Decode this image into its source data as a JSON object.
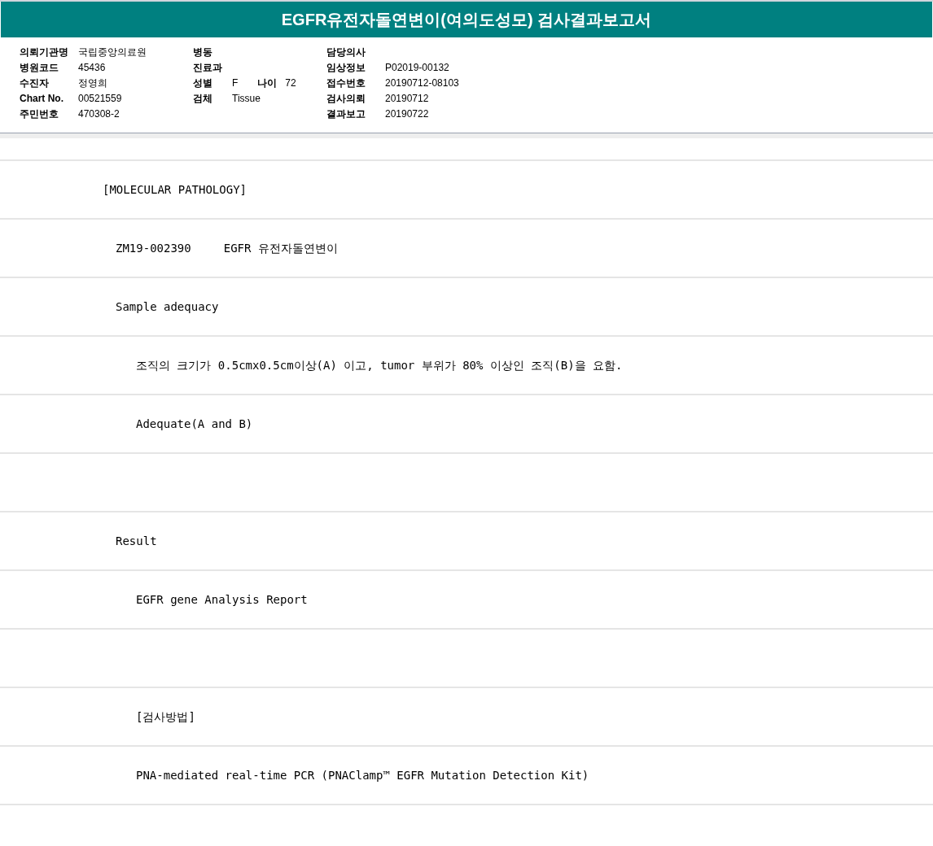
{
  "title": "EGFR유전자돌연변이(여의도성모) 검사결과보고서",
  "info_columns": [
    [
      [
        {
          "label": "의뢰기관명",
          "value": "국립중앙의료원"
        }
      ],
      [
        {
          "label": "병원코드",
          "value": "45436"
        }
      ],
      [
        {
          "label": "수진자",
          "value": "정영희"
        }
      ],
      [
        {
          "label": "Chart No.",
          "value": "00521559"
        }
      ],
      [
        {
          "label": "주민번호",
          "value": "470308-2"
        }
      ]
    ],
    [
      [
        {
          "label": "병동"
        }
      ],
      [
        {
          "label": "진료과"
        }
      ],
      [
        {
          "label": "성별",
          "value": "F"
        },
        {
          "label": "나이",
          "value": "72"
        }
      ],
      [
        {
          "label": "검체",
          "value": "Tissue"
        }
      ]
    ],
    [
      [
        {
          "label": "담당의사"
        }
      ],
      [
        {
          "label": "임상정보",
          "value": "P02019-00132"
        }
      ],
      [
        {
          "label": "접수번호",
          "value": "20190712-08103"
        }
      ],
      [
        {
          "label": "검사의뢰",
          "value": "20190712"
        }
      ],
      [
        {
          "label": "결과보고",
          "value": "20190722"
        }
      ]
    ]
  ],
  "rows": [
    {
      "kind": "blank"
    },
    {
      "kind": "section",
      "texts": [
        "[MOLECULAR PATHOLOGY]"
      ]
    },
    {
      "kind": "item",
      "texts": [
        "ZM19-002390",
        "EGFR 유전자돌연변이"
      ]
    },
    {
      "kind": "item",
      "texts": [
        "Sample adequacy"
      ]
    },
    {
      "kind": "detail",
      "texts": [
        "조직의 크기가 0.5cmx0.5cm이상(A) 이고, tumor 부위가 80% 이상인 조직(B)을 요함."
      ]
    },
    {
      "kind": "detail",
      "texts": [
        "Adequate(A and B)"
      ]
    },
    {
      "kind": "blank"
    },
    {
      "kind": "item",
      "texts": [
        "Result"
      ]
    },
    {
      "kind": "detail",
      "texts": [
        "EGFR gene Analysis Report"
      ]
    },
    {
      "kind": "blank"
    },
    {
      "kind": "detail",
      "texts": [
        "[검사방법]"
      ]
    },
    {
      "kind": "detail",
      "texts": [
        "PNA-mediated real-time PCR (PNAClamp™ EGFR Mutation Detection Kit)"
      ]
    },
    {
      "kind": "blank"
    }
  ]
}
